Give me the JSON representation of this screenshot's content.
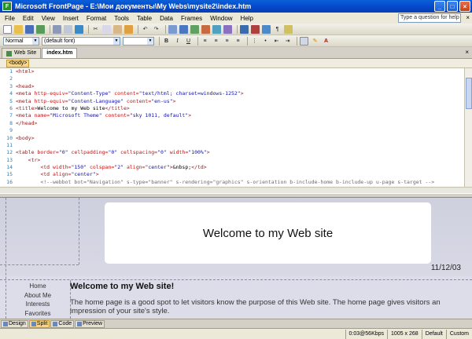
{
  "window": {
    "title": "Microsoft FrontPage - E:\\Мои документы\\My Webs\\mysite2\\index.htm"
  },
  "menu": [
    "File",
    "Edit",
    "View",
    "Insert",
    "Format",
    "Tools",
    "Table",
    "Data",
    "Frames",
    "Window",
    "Help"
  ],
  "help_placeholder": "Type a question for help",
  "format_toolbar": {
    "style": "Normal",
    "font": "(default font)"
  },
  "tabs": [
    "Web Site",
    "index.htm"
  ],
  "quick_tag": "<body>",
  "code_lines": [
    {
      "n": "1",
      "html": "<span class='tagc'>&lt;html&gt;</span>"
    },
    {
      "n": "2",
      "html": ""
    },
    {
      "n": "3",
      "html": "<span class='tagc'>&lt;head&gt;</span>"
    },
    {
      "n": "4",
      "html": "<span class='tagc'>&lt;meta</span> <span class='attr'>http-equiv=</span><span class='val'>\"Content-Type\"</span> <span class='attr'>content=</span><span class='val'>\"text/html; charset=windows-1252\"</span><span class='tagc'>&gt;</span>"
    },
    {
      "n": "5",
      "html": "<span class='tagc'>&lt;meta</span> <span class='attr'>http-equiv=</span><span class='val'>\"Content-Language\"</span> <span class='attr'>content=</span><span class='val'>\"en-us\"</span><span class='tagc'>&gt;</span>"
    },
    {
      "n": "6",
      "html": "<span class='tagc'>&lt;title&gt;</span>Welcome to my Web site<span class='tagc'>&lt;/title&gt;</span>"
    },
    {
      "n": "7",
      "html": "<span class='tagc'>&lt;meta</span> <span class='attr'>name=</span><span class='val'>\"Microsoft Theme\"</span> <span class='attr'>content=</span><span class='val'>\"sky 1011, default\"</span><span class='tagc'>&gt;</span>"
    },
    {
      "n": "8",
      "html": "<span class='tagc'>&lt;/head&gt;</span>"
    },
    {
      "n": "9",
      "html": ""
    },
    {
      "n": "10",
      "html": "<span class='tagc'>&lt;body&gt;</span>"
    },
    {
      "n": "11",
      "html": ""
    },
    {
      "n": "12",
      "html": "<span class='tagc'>&lt;table</span> <span class='attr'>border=</span><span class='val'>\"0\"</span> <span class='attr'>cellpadding=</span><span class='val'>\"0\"</span> <span class='attr'>cellspacing=</span><span class='val'>\"0\"</span> <span class='attr'>width=</span><span class='val'>\"100%\"</span><span class='tagc'>&gt;</span>"
    },
    {
      "n": "13",
      "html": "    <span class='tagc'>&lt;tr&gt;</span>"
    },
    {
      "n": "14",
      "html": "        <span class='tagc'>&lt;td</span> <span class='attr'>width=</span><span class='val'>\"150\"</span> <span class='attr'>colspan=</span><span class='val'>\"2\"</span> <span class='attr'>align=</span><span class='val'>\"center\"</span><span class='tagc'>&gt;</span>&amp;nbsp;<span class='tagc'>&lt;/td&gt;</span>"
    },
    {
      "n": "15",
      "html": "        <span class='tagc'>&lt;td</span> <span class='attr'>align=</span><span class='val'>\"center\"</span><span class='tagc'>&gt;</span>"
    },
    {
      "n": "16",
      "html": "        <span class='cmt'>&lt;!--webbot bot=\"Navigation\" s-type=\"banner\" s-rendering=\"graphics\" s-orientation b-include-home b-include-up u-page s-target --&gt;</span>"
    }
  ],
  "design": {
    "banner_text": "Welcome to my Web site",
    "date": "11/12/03",
    "nav": [
      "Home",
      "About Me",
      "Interests",
      "Favorites"
    ],
    "heading": "Welcome to my Web site!",
    "body_text": "The home page is a good spot to let visitors know the purpose of this Web site. The home page gives visitors an impression of your site's style."
  },
  "view_tabs": [
    "Design",
    "Split",
    "Code",
    "Preview"
  ],
  "status": {
    "speed": "0:03@56Kbps",
    "size": "1005 x 268",
    "style": "Default",
    "mode": "Custom"
  }
}
